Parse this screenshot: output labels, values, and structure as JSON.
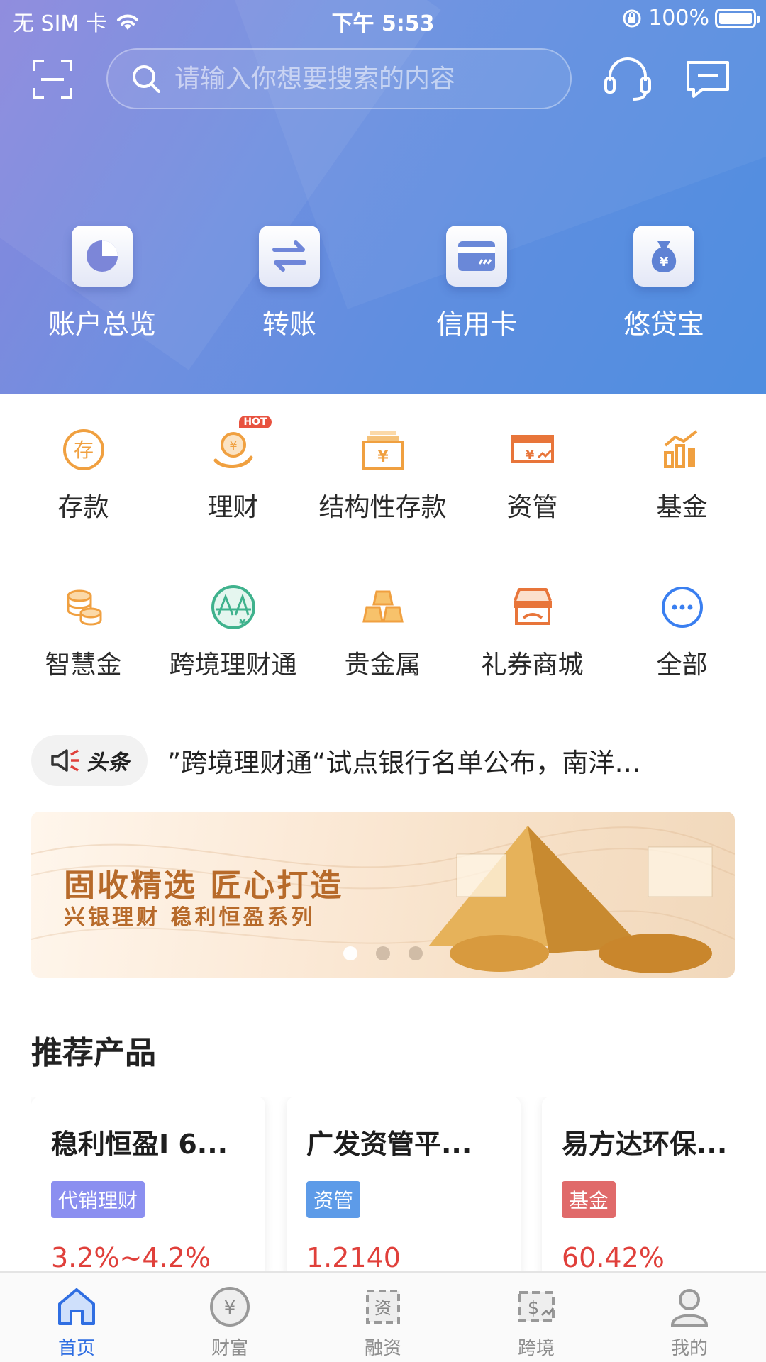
{
  "status_bar": {
    "carrier": "无 SIM 卡",
    "time": "下午 5:53",
    "battery": "100%"
  },
  "header": {
    "search_placeholder": "请输入你想要搜索的内容",
    "icons": [
      "scan-icon",
      "search-icon",
      "headset-icon",
      "message-icon"
    ]
  },
  "quick_actions": [
    {
      "label": "账户总览",
      "icon": "pie-chart-icon"
    },
    {
      "label": "转账",
      "icon": "transfer-icon"
    },
    {
      "label": "信用卡",
      "icon": "credit-card-icon"
    },
    {
      "label": "悠贷宝",
      "icon": "money-bag-icon"
    }
  ],
  "services": {
    "row1": [
      {
        "label": "存款",
        "icon": "deposit-icon"
      },
      {
        "label": "理财",
        "icon": "wealth-icon",
        "badge": "HOT"
      },
      {
        "label": "结构性存款",
        "icon": "structured-deposit-icon"
      },
      {
        "label": "资管",
        "icon": "asset-management-icon"
      },
      {
        "label": "基金",
        "icon": "fund-icon"
      }
    ],
    "row2": [
      {
        "label": "智慧金",
        "icon": "gold-coins-icon"
      },
      {
        "label": "跨境理财通",
        "icon": "cross-border-icon"
      },
      {
        "label": "贵金属",
        "icon": "gold-bars-icon"
      },
      {
        "label": "礼券商城",
        "icon": "coupon-store-icon"
      },
      {
        "label": "全部",
        "icon": "more-icon"
      }
    ]
  },
  "news": {
    "tag": "头条",
    "headline": "”跨境理财通“试点银行名单公布，南洋…"
  },
  "banner": {
    "title": "固收精选  匠心打造",
    "subtitle": "兴银理财  稳利恒盈系列",
    "active_index": 0,
    "count": 3
  },
  "recommended": {
    "title": "推荐产品",
    "items": [
      {
        "name": "稳利恒盈I 6...",
        "tag": "代销理财",
        "tag_color": "#8b8ff0",
        "rate": "3.2%~4.2%"
      },
      {
        "name": "广发资管平...",
        "tag": "资管",
        "tag_color": "#5d9be8",
        "rate": "1.2140"
      },
      {
        "name": "易方达环保...",
        "tag": "基金",
        "tag_color": "#e06a6a",
        "rate": "60.42%"
      }
    ]
  },
  "tabbar": {
    "items": [
      {
        "label": "首页",
        "icon": "home-icon",
        "active": true
      },
      {
        "label": "财富",
        "icon": "wealth-coin-icon",
        "active": false
      },
      {
        "label": "融资",
        "icon": "financing-icon",
        "active": false
      },
      {
        "label": "跨境",
        "icon": "cross-border-dollar-icon",
        "active": false
      },
      {
        "label": "我的",
        "icon": "profile-icon",
        "active": false
      }
    ]
  },
  "colors": {
    "accent": "#2f6ee2",
    "orange_icon": "#f0a040",
    "rate_red": "#e0403b"
  }
}
